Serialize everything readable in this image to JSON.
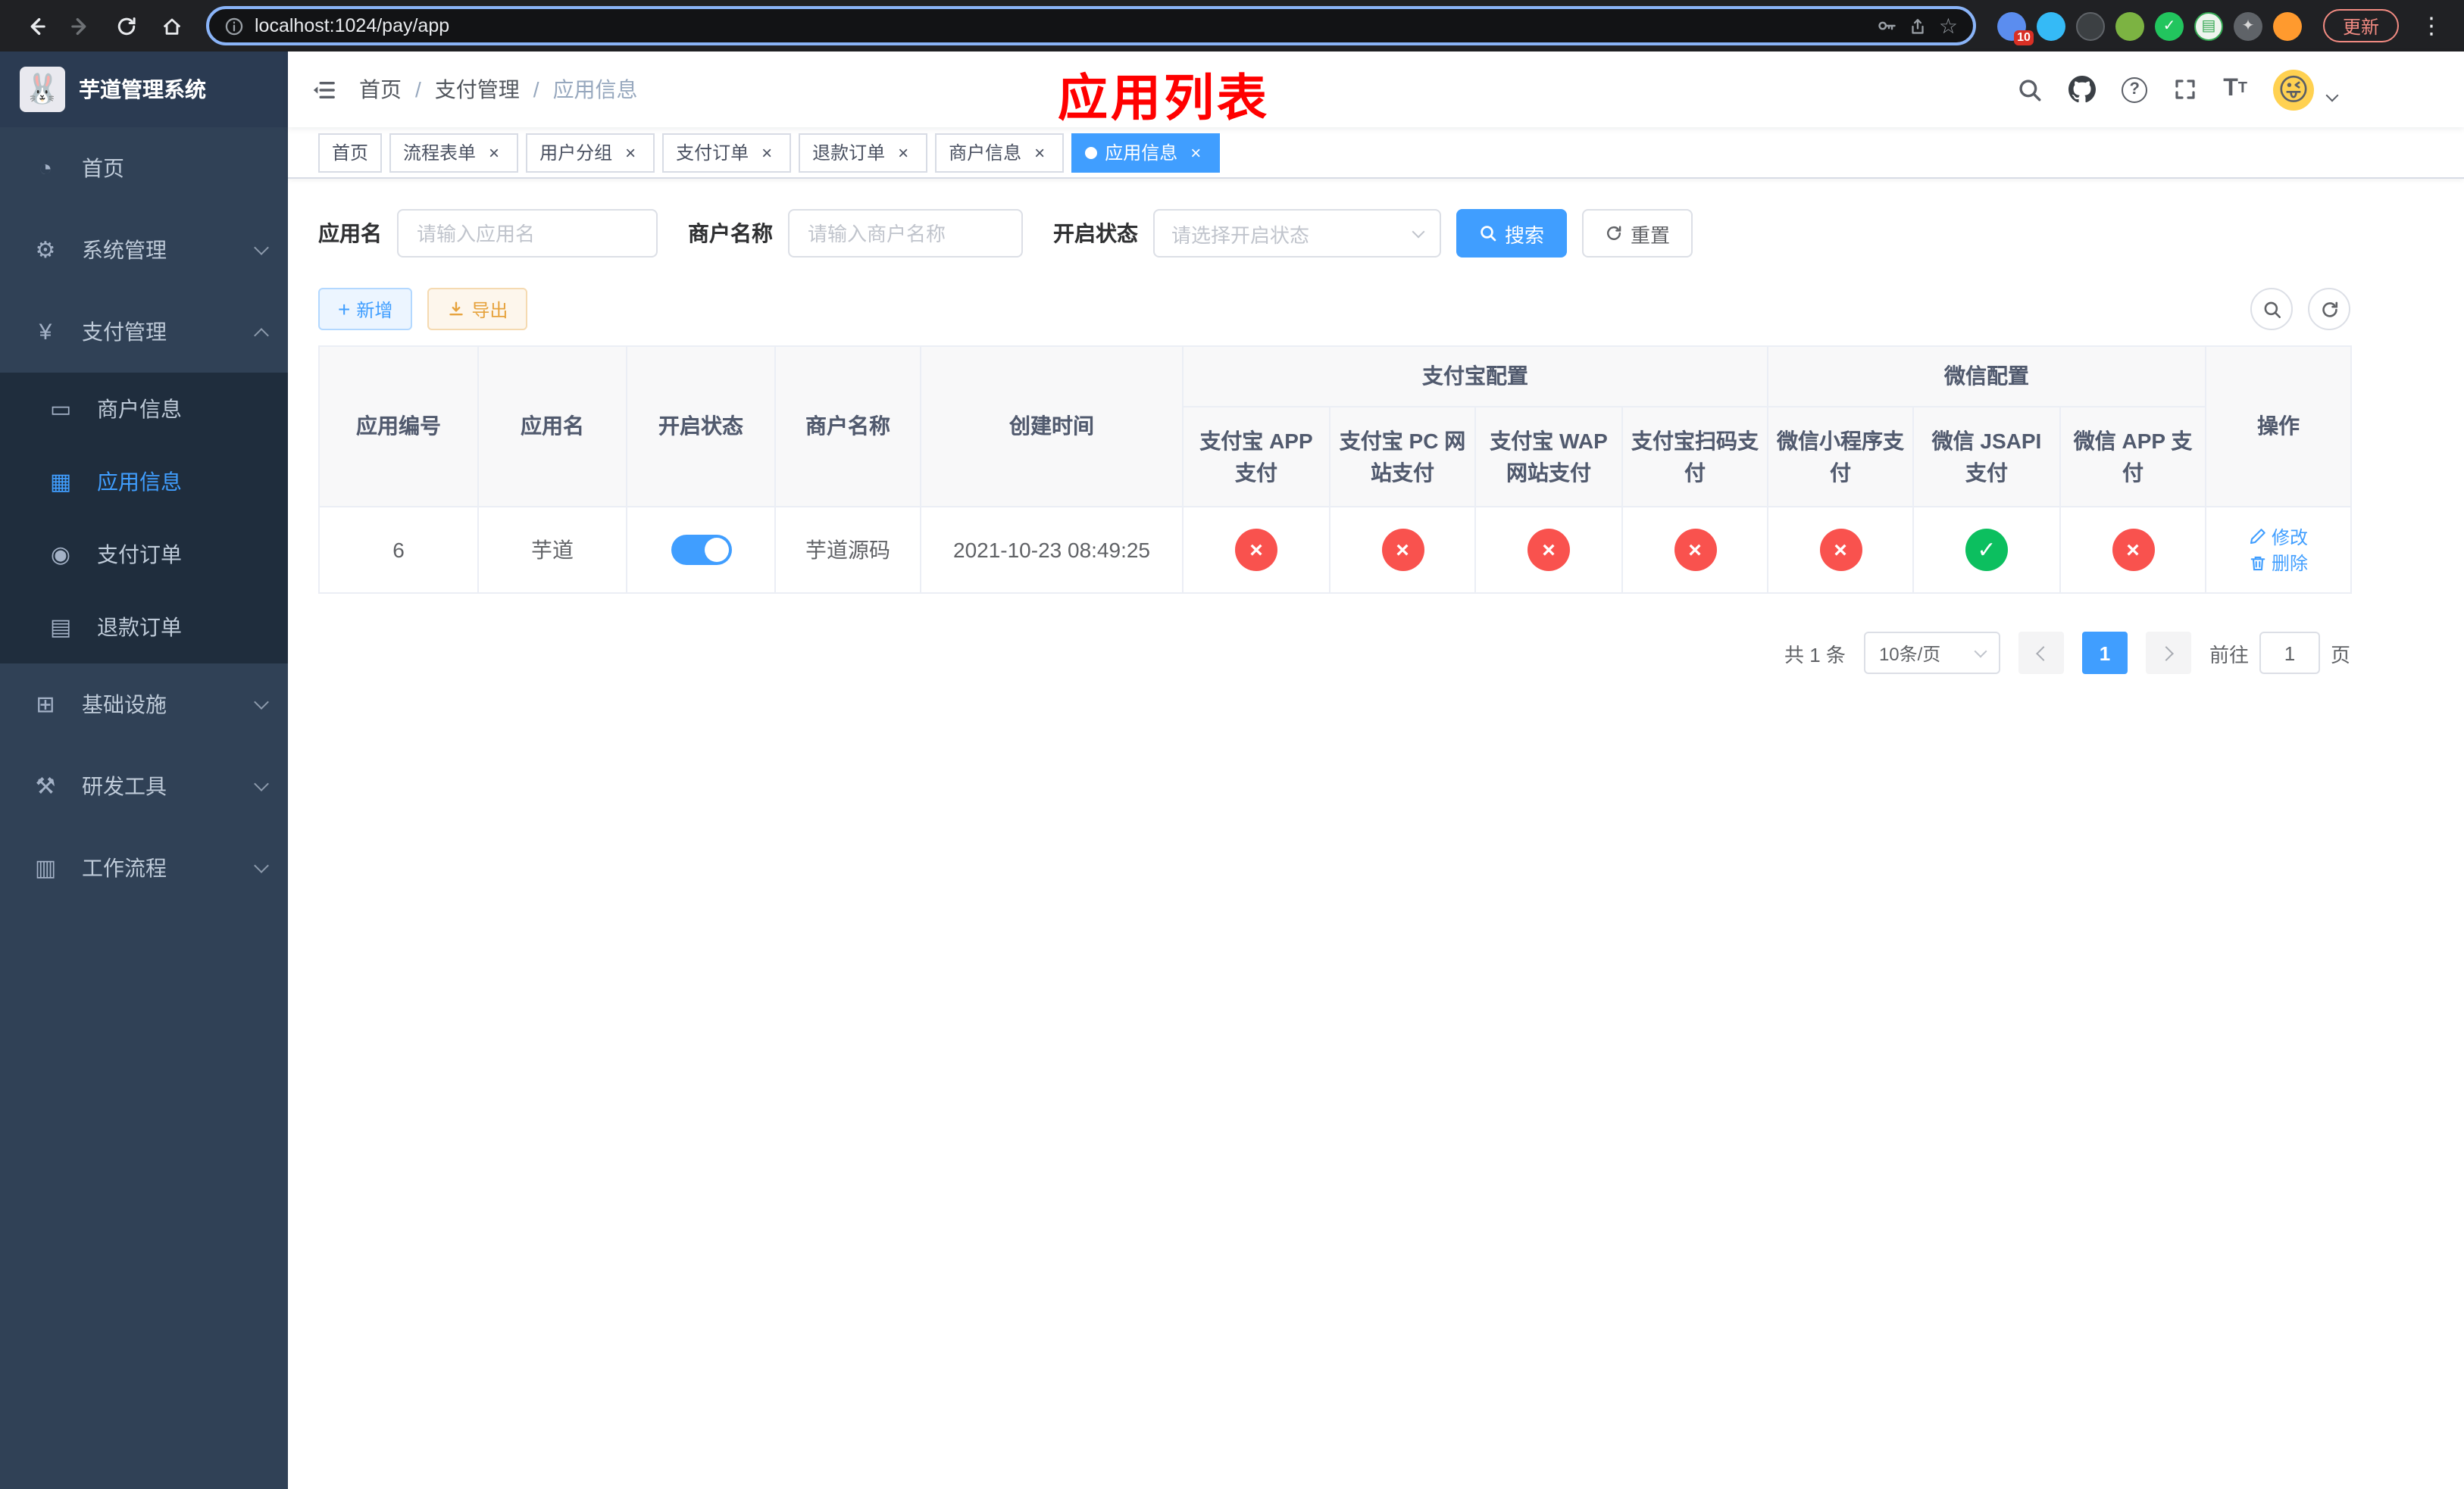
{
  "colors": {
    "accent": "#409eff",
    "accent_light_bg": "#ecf5ff",
    "accent_light_border": "#b3d8ff",
    "warning": "#e6a23c",
    "warning_bg": "#fdf6ec",
    "warning_border": "#f5dab1",
    "success": "#0cbf5f",
    "danger": "#f9524e",
    "marker": "#ff0000",
    "sidebar_bg": "#304156",
    "submenu_bg": "#1f2d3d",
    "sidebar_text": "#bfcbd9",
    "chrome_bg": "#202124"
  },
  "icons": {
    "check": "✓",
    "cross": "×"
  },
  "browser": {
    "url": "localhost:1024/pay/app",
    "update_label": "更新",
    "extension_badge": "10"
  },
  "sidebar": {
    "title": "芋道管理系统",
    "items": [
      {
        "label": "首页"
      },
      {
        "label": "系统管理"
      },
      {
        "label": "支付管理"
      },
      {
        "label": "基础设施"
      },
      {
        "label": "研发工具"
      },
      {
        "label": "工作流程"
      }
    ],
    "payment_children": [
      {
        "label": "商户信息"
      },
      {
        "label": "应用信息"
      },
      {
        "label": "支付订单"
      },
      {
        "label": "退款订单"
      }
    ]
  },
  "header": {
    "breadcrumb": [
      "首页",
      "支付管理",
      "应用信息"
    ],
    "marker": "应用列表"
  },
  "tabs": [
    {
      "label": "首页"
    },
    {
      "label": "流程表单"
    },
    {
      "label": "用户分组"
    },
    {
      "label": "支付订单"
    },
    {
      "label": "退款订单"
    },
    {
      "label": "商户信息"
    },
    {
      "label": "应用信息"
    }
  ],
  "filters": {
    "app_name_label": "应用名",
    "app_name_placeholder": "请输入应用名",
    "merchant_label": "商户名称",
    "merchant_placeholder": "请输入商户名称",
    "status_label": "开启状态",
    "status_placeholder": "请选择开启状态",
    "search_label": "搜索",
    "reset_label": "重置"
  },
  "toolbar": {
    "add_label": "新增",
    "export_label": "导出"
  },
  "table": {
    "group_alipay": "支付宝配置",
    "group_wechat": "微信配置",
    "col_id": "应用编号",
    "col_name": "应用名",
    "col_status": "开启状态",
    "col_merchant": "商户名称",
    "col_created": "创建时间",
    "col_ops": "操作",
    "alipay_cols": [
      "支付宝 APP 支付",
      "支付宝 PC 网站支付",
      "支付宝 WAP 网站支付",
      "支付宝扫码支付"
    ],
    "wechat_cols": [
      "微信小程序支付",
      "微信 JSAPI 支付",
      "微信 APP 支付"
    ],
    "rows": [
      {
        "id": "6",
        "name": "芋道",
        "enabled": true,
        "merchant": "芋道源码",
        "created": "2021-10-23 08:49:25",
        "configs": [
          false,
          false,
          false,
          false,
          false,
          true,
          false
        ],
        "edit_label": "修改",
        "delete_label": "删除"
      }
    ]
  },
  "pagination": {
    "total_text": "共 1 条",
    "page_size": "10条/页",
    "current_page": "1",
    "goto_label": "前往",
    "goto_value": "1",
    "page_unit": "页"
  }
}
